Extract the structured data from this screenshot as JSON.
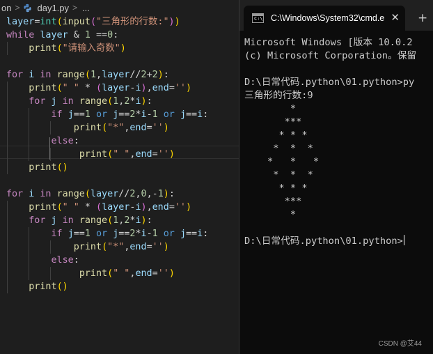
{
  "editor": {
    "breadcrumb": {
      "folder": "on",
      "file": "day1.py",
      "more": "..."
    },
    "lines": [
      "layer=int(input(\"三角形的行数:\"))",
      "while layer & 1 ==0:",
      "    print(\"请输入奇数\")",
      "",
      "for i in range(1,layer//2+2):",
      "    print(\" \" * (layer-i),end='')",
      "    for j in range(1,2*i):",
      "        if j==1 or j==2*i-1 or j==i:",
      "            print(\"*\",end='')",
      "        else:",
      "             print(\" \",end='')",
      "    print()",
      "",
      "for i in range(layer//2,0,-1):",
      "    print(\" \" * (layer-i),end='')",
      "    for j in range(1,2*i):",
      "        if j==1 or j==2*i-1 or j==i:",
      "            print(\"*\",end='')",
      "        else:",
      "             print(\" \",end='')",
      "    print()"
    ]
  },
  "terminal": {
    "tab_title": "C:\\Windows\\System32\\cmd.e",
    "close_glyph": "✕",
    "new_tab_glyph": "+",
    "console_lines": [
      "Microsoft Windows [版本 10.0.2",
      "(c) Microsoft Corporation。保留",
      "",
      "D:\\日常代码.python\\01.python>py",
      "三角形的行数:9",
      "        *",
      "       ***",
      "      * * *",
      "     *  *  *",
      "    *   *   *",
      "     *  *  *",
      "      * * *",
      "       ***",
      "        *",
      "",
      "D:\\日常代码.python\\01.python>"
    ],
    "watermark": "CSDN @艾44"
  },
  "colors": {
    "editor_bg": "#1e1e1e",
    "terminal_bg": "#0c0c0c",
    "tabbar_bg": "#202020",
    "keyword": "#c586c0",
    "string": "#ce9178",
    "function": "#dcdcaa"
  },
  "icons": {
    "python_file": "python-icon",
    "cmd": "cmd-icon"
  }
}
